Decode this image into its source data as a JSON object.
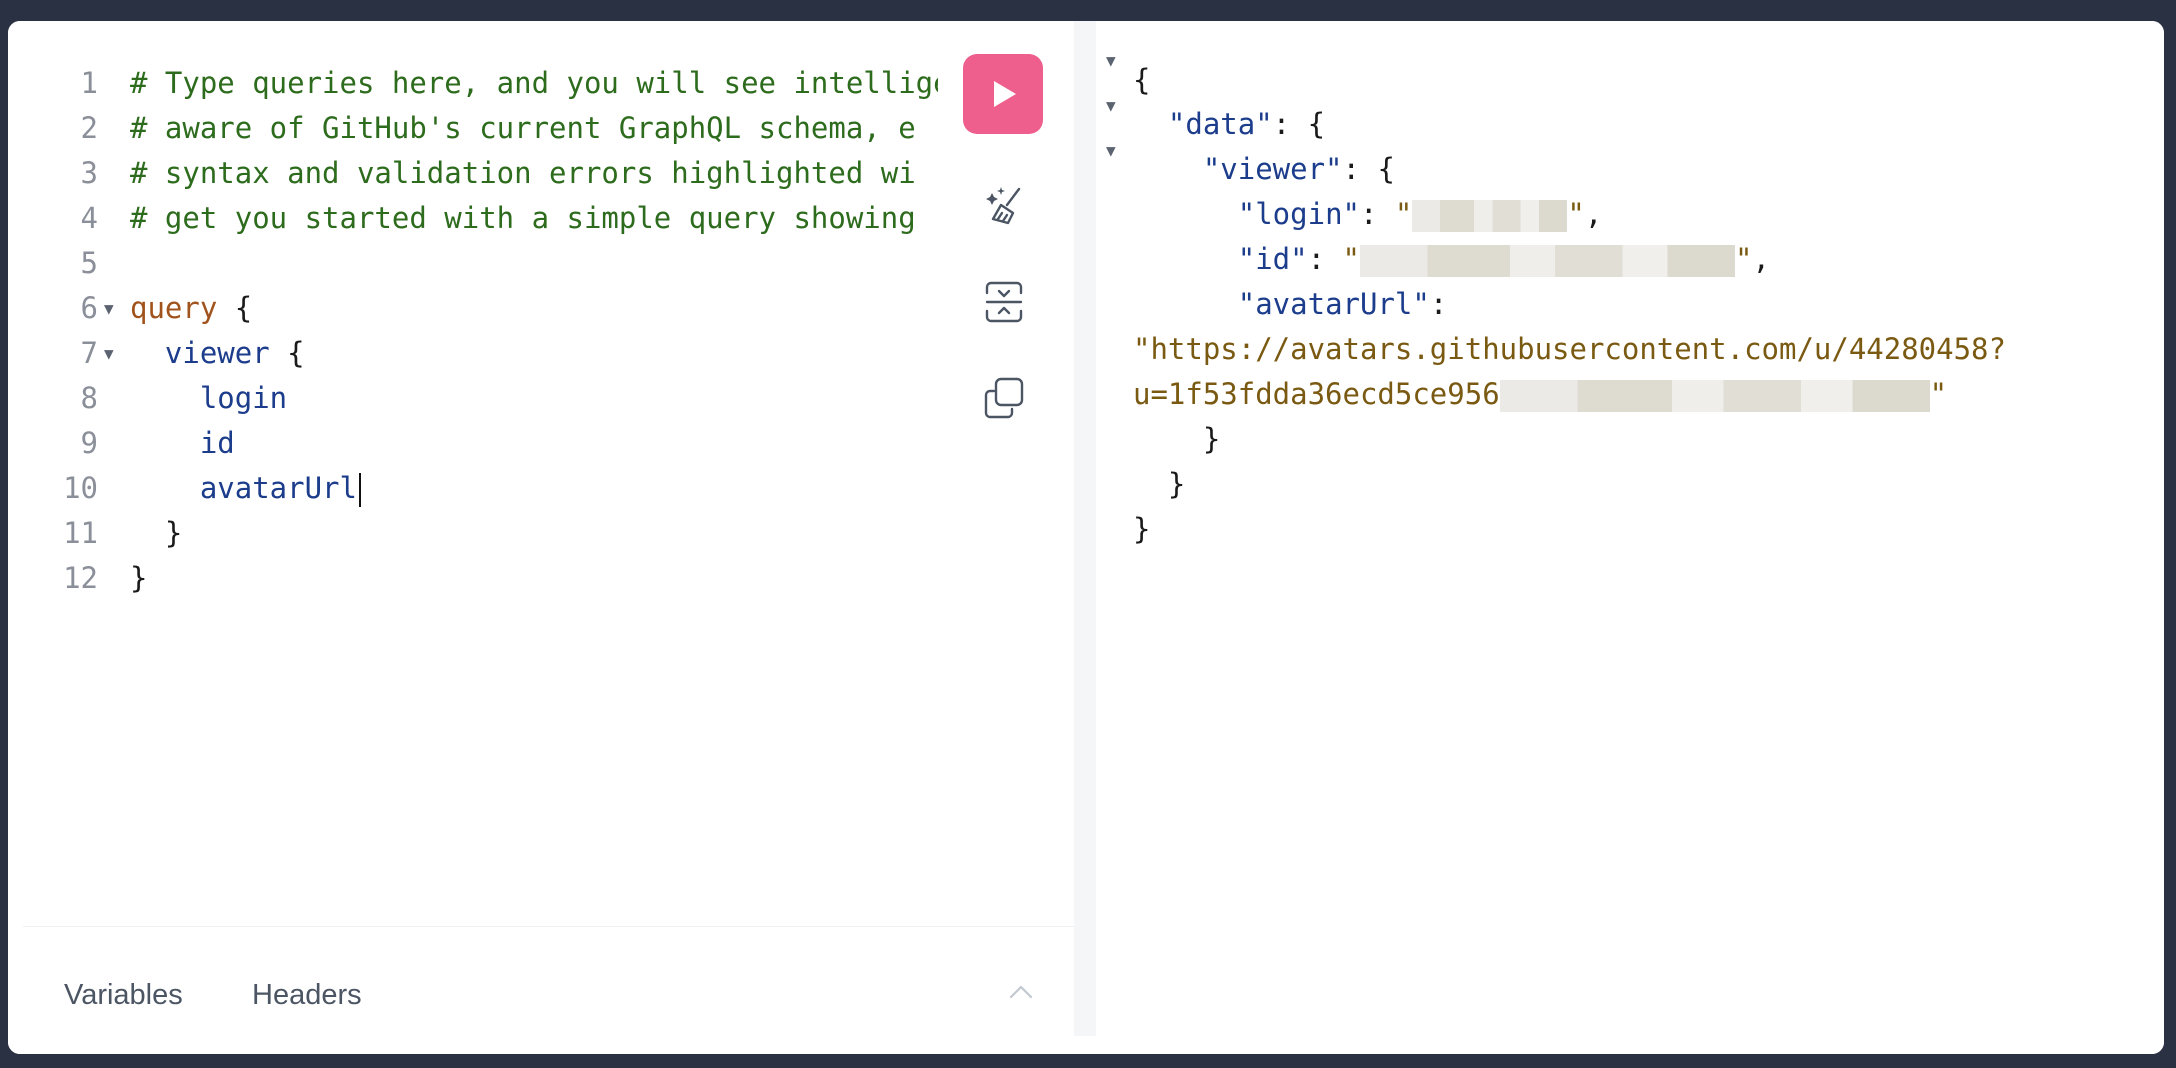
{
  "editor": {
    "lines": [
      {
        "n": "1",
        "text": "# Type queries here, and you will see intelligent",
        "cls": "c-comment"
      },
      {
        "n": "2",
        "text": "# aware of GitHub's current GraphQL schema, e",
        "cls": "c-comment"
      },
      {
        "n": "3",
        "text": "# syntax and validation errors highlighted wi",
        "cls": "c-comment"
      },
      {
        "n": "4",
        "text": "# get you started with a simple query showing",
        "cls": "c-comment"
      },
      {
        "n": "5",
        "text": "",
        "cls": "c-punc"
      },
      {
        "n": "6",
        "kw": "query",
        "rest": " {"
      },
      {
        "n": "7",
        "field": "viewer",
        "rest": " {"
      },
      {
        "n": "8",
        "text": "login",
        "cls": "c-field"
      },
      {
        "n": "9",
        "text": "id",
        "cls": "c-field"
      },
      {
        "n": "10",
        "text": "avatarUrl",
        "cls": "c-field"
      },
      {
        "n": "11",
        "text": "}",
        "cls": "c-punc"
      },
      {
        "n": "12",
        "text": "}",
        "cls": "c-punc"
      }
    ]
  },
  "toolbar": {
    "run": "play-icon",
    "prettify": "prettify-sparkle-brush-icon",
    "merge": "merge-fragments-icon",
    "copy": "copy-icon"
  },
  "variables_bar": {
    "tab_variables": "Variables",
    "tab_headers": "Headers"
  },
  "result": {
    "open_brace": "{",
    "data_key": "\"data\"",
    "viewer_key": "\"viewer\"",
    "login_key": "\"login\"",
    "id_key": "\"id\"",
    "avatar_key": "\"avatarUrl\"",
    "avatar_value_line1": "\"https://avatars.githubusercontent.com/u/44280458?",
    "avatar_value_line2": "u=1f53fdda36ecd5ce956",
    "close_brace": "}"
  },
  "colors": {
    "run_button": "#ef5f8d",
    "comment": "#2d6b1d",
    "keyword": "#a0531c",
    "field": "#1c3c8c",
    "string": "#7a5a12",
    "window_frame": "#2a3142"
  }
}
